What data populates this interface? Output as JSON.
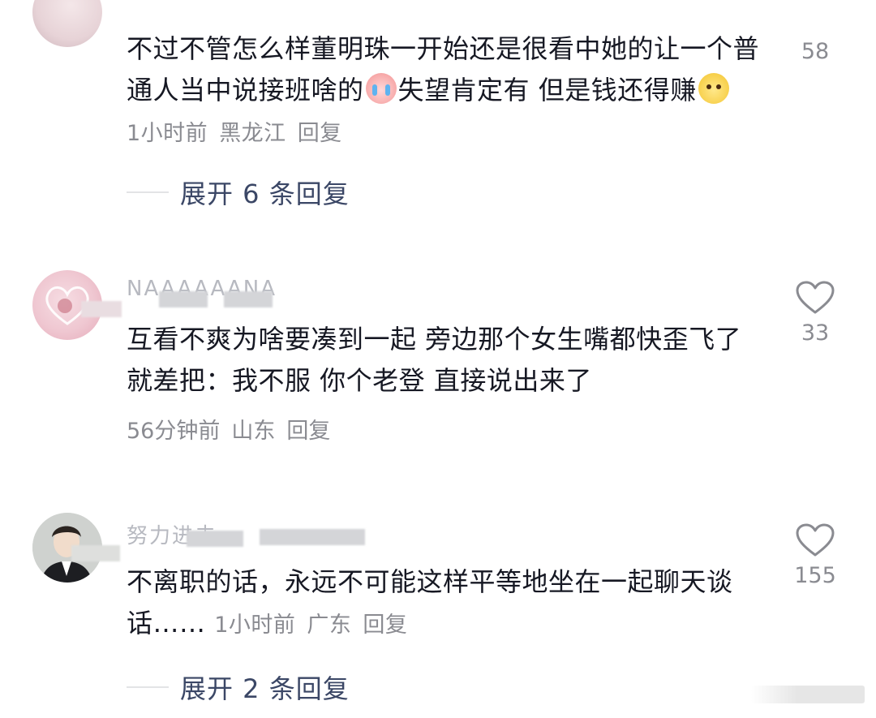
{
  "comments": [
    {
      "text_a": "不过不管怎么样董明珠一开始还是很看中她的让一个普通人当中说接班啥的",
      "emoji_a": "cry-emoji",
      "text_b": "失望肯定有 但是钱还得赚",
      "emoji_b": "money-emoji",
      "time": "1小时前",
      "location": "黑龙江",
      "reply": "回复",
      "likes": "58",
      "expand": "展开 6 条回复"
    },
    {
      "username": "NAAAAAANA",
      "text": "互看不爽为啥要凑到一起 旁边那个女生嘴都快歪飞了 就差把：我不服 你个老登 直接说出来了",
      "time": "56分钟前",
      "location": "山东",
      "reply": "回复",
      "likes": "33"
    },
    {
      "username": "努力进去",
      "text": "不离职的话，永远不可能这样平等地坐在一起聊天谈话……",
      "time": "1小时前",
      "location": "广东",
      "reply": "回复",
      "likes": "155",
      "expand": "展开 2 条回复"
    }
  ]
}
